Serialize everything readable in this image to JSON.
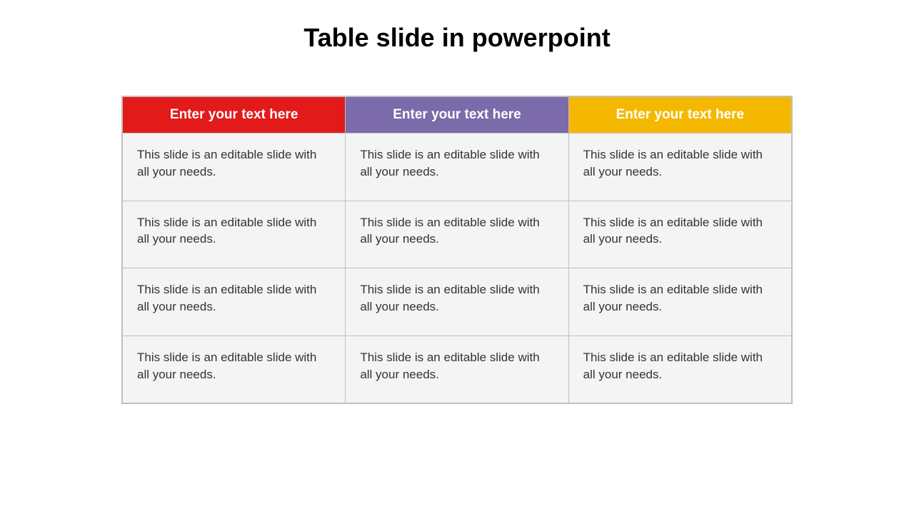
{
  "page": {
    "title": "Table slide in powerpoint"
  },
  "table": {
    "headers": [
      {
        "label": "Enter your text here",
        "color_class": "col-red"
      },
      {
        "label": "Enter your text here",
        "color_class": "col-purple"
      },
      {
        "label": "Enter your text here",
        "color_class": "col-yellow"
      }
    ],
    "rows": [
      [
        "This slide is an editable slide with all your needs.",
        "This slide is an editable slide with all your needs.",
        "This slide is an editable slide with all your needs."
      ],
      [
        "This slide is an editable slide with all your needs.",
        "This slide is an editable slide with all your needs.",
        "This slide is an editable slide with all your needs."
      ],
      [
        "This slide is an editable slide with all your needs.",
        "This slide is an editable slide with all your needs.",
        "This slide is an editable slide with all your needs."
      ],
      [
        "This slide is an editable slide with all your needs.",
        "This slide is an editable slide with all your needs.",
        "This slide is an editable slide with all your needs."
      ]
    ]
  }
}
